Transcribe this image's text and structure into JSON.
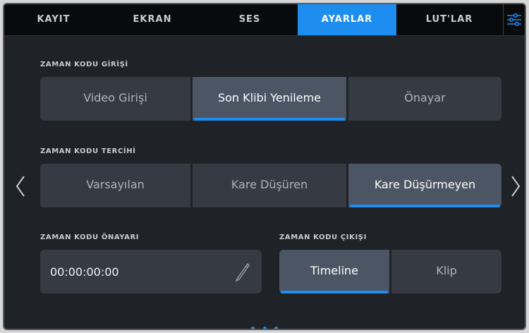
{
  "tabs": [
    {
      "label": "KAYIT",
      "active": false
    },
    {
      "label": "EKRAN",
      "active": false
    },
    {
      "label": "SES",
      "active": false
    },
    {
      "label": "AYARLAR",
      "active": true
    },
    {
      "label": "LUT'LAR",
      "active": false
    }
  ],
  "menu_icon": "sliders-icon",
  "timecode_input": {
    "label": "ZAMAN KODU GİRİŞİ",
    "options": [
      "Video Girişi",
      "Son Klibi Yenileme",
      "Önayar"
    ],
    "selected": "Son Klibi Yenileme"
  },
  "timecode_preference": {
    "label": "ZAMAN KODU TERCİHİ",
    "options": [
      "Varsayılan",
      "Kare Düşüren",
      "Kare Düşürmeyen"
    ],
    "selected": "Kare Düşürmeyen"
  },
  "timecode_preset": {
    "label": "ZAMAN KODU ÖNAYARI",
    "value": "00:00:00:00",
    "edit_icon": "pencil-icon"
  },
  "timecode_output": {
    "label": "ZAMAN KODU ÇIKIŞI",
    "options": [
      "Timeline",
      "Klip"
    ],
    "selected": "Timeline"
  },
  "pagination": {
    "pages": 3,
    "current": 2
  },
  "colors": {
    "accent": "#1d8df0",
    "background": "#1f2227",
    "segment": "#363a42",
    "segment_selected": "#4c5563"
  }
}
